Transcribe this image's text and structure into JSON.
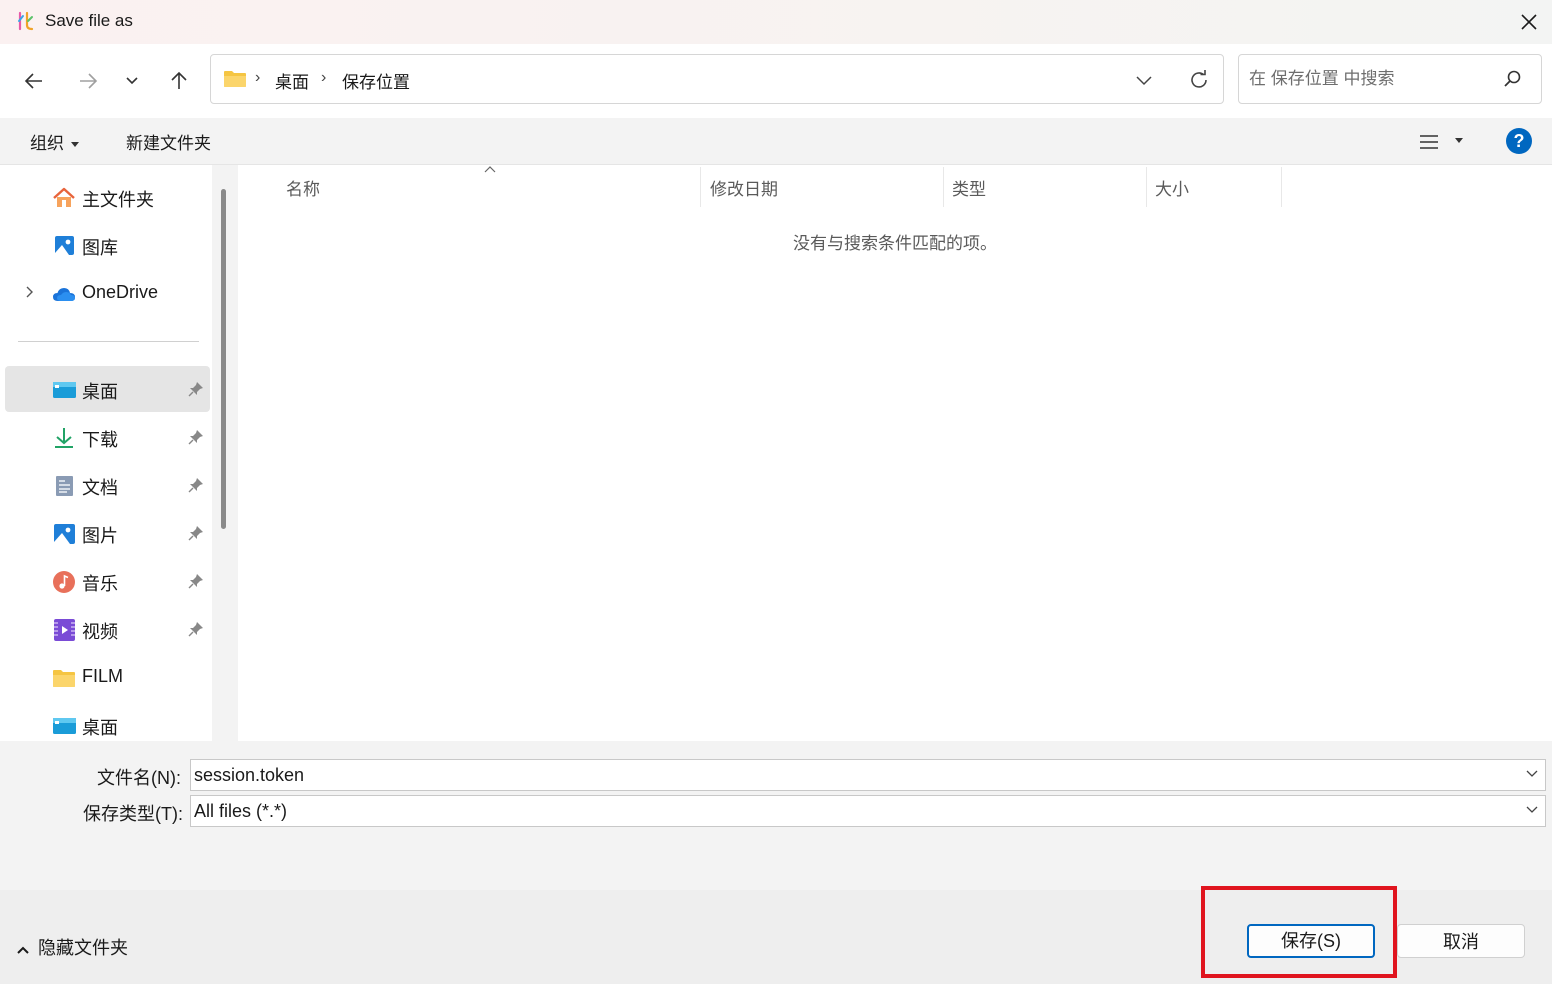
{
  "window": {
    "title": "Save file as",
    "close_icon": "close-icon"
  },
  "navigation": {
    "back_icon": "arrow-left-icon",
    "forward_icon": "arrow-right-icon",
    "recent_icon": "chevron-down-icon",
    "up_icon": "arrow-up-icon"
  },
  "address": {
    "crumbs": [
      "桌面",
      "保存位置"
    ],
    "separator": "›",
    "folder_icon": "folder-icon"
  },
  "search": {
    "placeholder": "在 保存位置 中搜索",
    "value": ""
  },
  "toolbar": {
    "organize_label": "组织",
    "new_folder_label": "新建文件夹",
    "help_label": "?"
  },
  "sidebar": {
    "items": [
      {
        "label": "主文件夹",
        "icon": "home-icon"
      },
      {
        "label": "图库",
        "icon": "gallery-icon"
      },
      {
        "label": "OneDrive",
        "icon": "onedrive-icon"
      },
      {
        "label": "桌面",
        "icon": "desktop-icon",
        "pinned": true,
        "selected": true
      },
      {
        "label": "下载",
        "icon": "download-icon",
        "pinned": true
      },
      {
        "label": "文档",
        "icon": "document-icon",
        "pinned": true
      },
      {
        "label": "图片",
        "icon": "pictures-icon",
        "pinned": true
      },
      {
        "label": "音乐",
        "icon": "music-icon",
        "pinned": true
      },
      {
        "label": "视频",
        "icon": "video-icon",
        "pinned": true
      },
      {
        "label": "FILM",
        "icon": "folder-icon"
      },
      {
        "label": "桌面",
        "icon": "desktop-icon"
      }
    ]
  },
  "file_list": {
    "columns": [
      "名称",
      "修改日期",
      "类型",
      "大小"
    ],
    "empty_message": "没有与搜索条件匹配的项。"
  },
  "form": {
    "filename_label": "文件名(N):",
    "filename_value": "session.token",
    "filetype_label": "保存类型(T):",
    "filetype_value": "All files (*.*)"
  },
  "footer": {
    "hide_folders_label": "隐藏文件夹",
    "save_label": "保存(S)",
    "cancel_label": "取消"
  },
  "colors": {
    "accent": "#0067c0",
    "highlight": "#e0141e"
  }
}
